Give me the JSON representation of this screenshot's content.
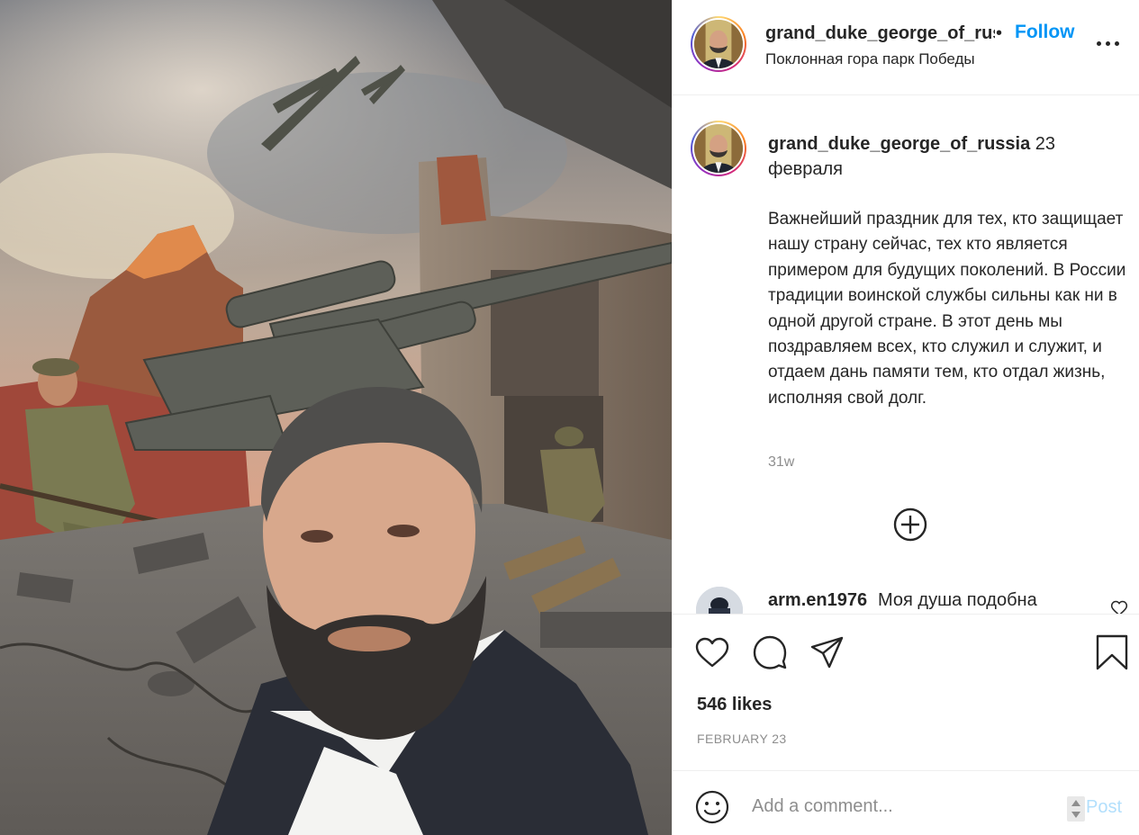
{
  "post": {
    "header": {
      "username": "grand_duke_george_of_russia",
      "separator": "•",
      "follow_label": "Follow",
      "location": "Поклонная гора парк Победы",
      "more_icon": "more-options-icon"
    },
    "caption": {
      "username": "grand_duke_george_of_russia",
      "date_suffix": "23 февраля",
      "text": "Важнейший праздник для тех, кто защищает нашу страну сейчас, тех кто является примером для будущих поколений. В России традиции воинской службы сильны как ни в одной другой стране. В этот день мы поздравляем всех, кто служил и служит, и отдаем дань памяти тем, кто отдал жизнь, исполняя свой долг.",
      "age": "31w"
    },
    "load_more_icon": "plus-circle-icon",
    "comments": [
      {
        "username": "arm.en1976",
        "text": "Моя душа подобна"
      }
    ],
    "actions": {
      "icons": [
        "heart-icon",
        "comment-icon",
        "share-icon",
        "bookmark-icon"
      ],
      "likes": "546 likes",
      "date": "FEBRUARY 23"
    },
    "add_comment": {
      "placeholder": "Add a comment...",
      "post_label": "Post",
      "emoji_icon": "smile-icon"
    }
  },
  "colors": {
    "accent": "#0095f6",
    "post_disabled": "#b2dffc",
    "text": "#262626",
    "secondary": "#8e8e8e",
    "border": "#efefef"
  }
}
